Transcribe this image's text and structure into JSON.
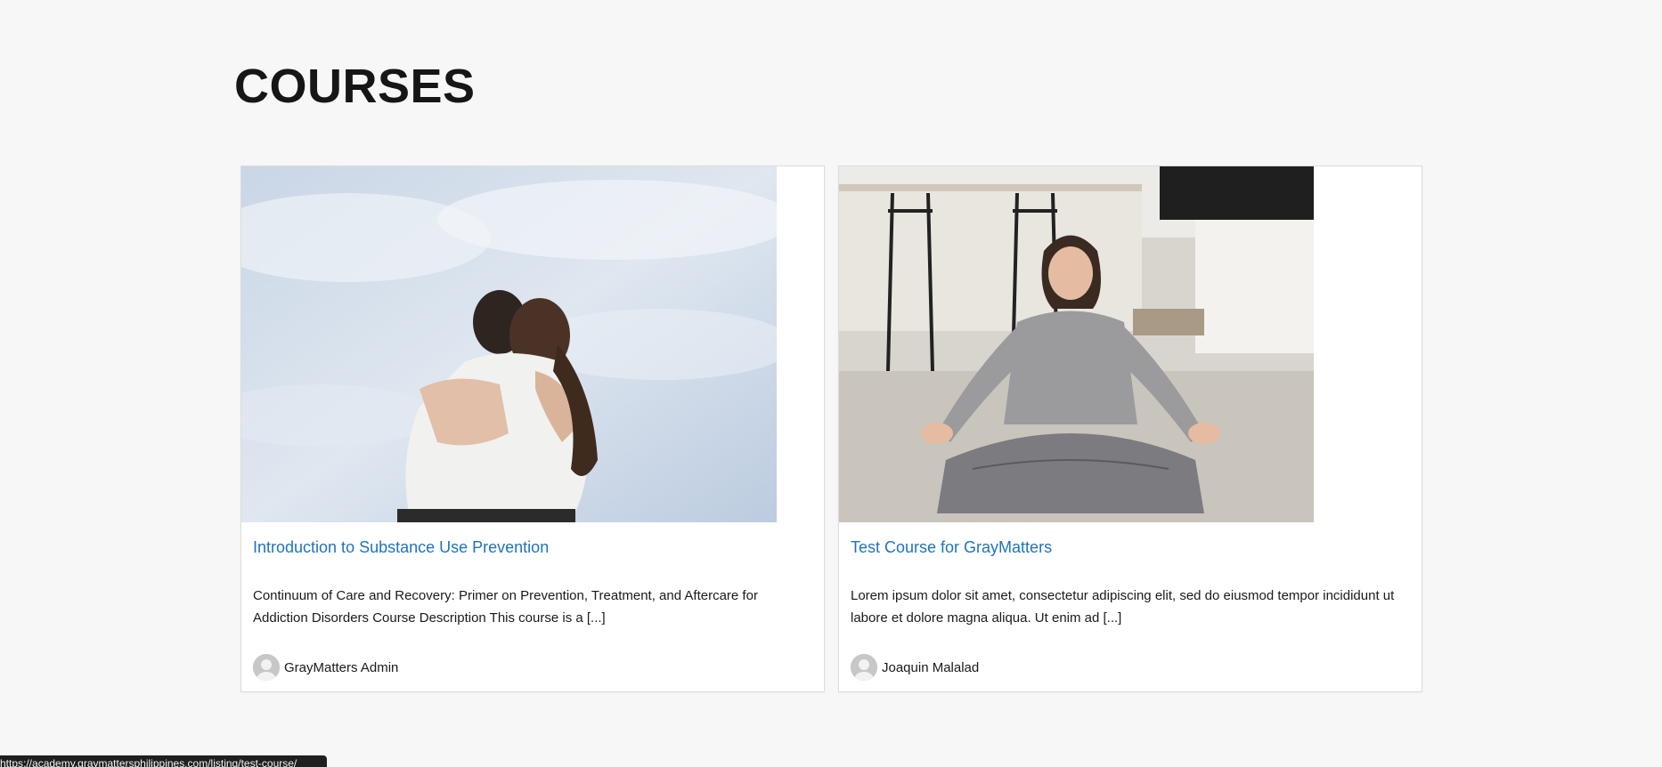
{
  "page": {
    "title": "COURSES"
  },
  "courses": [
    {
      "title": "Introduction to Substance Use Prevention",
      "excerpt": "Continuum of Care and Recovery: Primer on Prevention, Treatment, and Aftercare for Addiction Disorders Course Description This course is a [...]",
      "author": "GrayMatters Admin",
      "image_alt": "two people hugging under a cloudy sky"
    },
    {
      "title": "Test Course for GrayMatters",
      "excerpt": "Lorem ipsum dolor sit amet, consectetur adipiscing elit, sed do eiusmod tempor incididunt ut labore et dolore magna aliqua. Ut enim ad [...]",
      "author": "Joaquin Malalad",
      "image_alt": "woman meditating cross-legged on floor"
    }
  ],
  "status_bar": {
    "url": "https://academy.graymattersphilippines.com/listing/test-course/"
  },
  "colors": {
    "background": "#f7f7f7",
    "title_link": "#1e73be",
    "heading": "#161616"
  }
}
